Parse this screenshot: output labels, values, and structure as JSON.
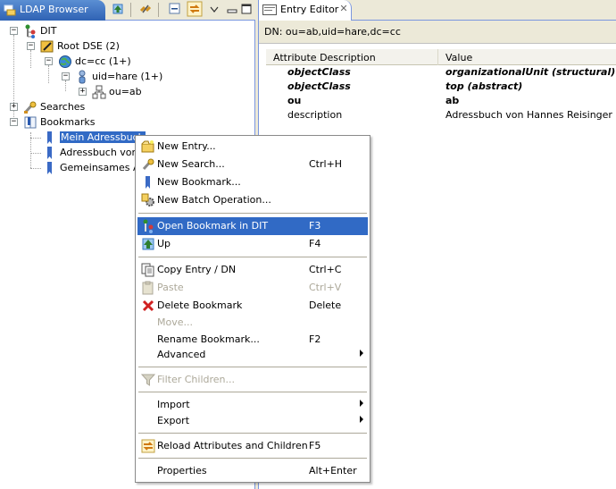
{
  "left_view": {
    "tab_title": "LDAP Browser"
  },
  "tree": {
    "dit": "DIT",
    "root_dse": "Root DSE (2)",
    "dc_cc": "dc=cc  (1+)",
    "uid_hare": "uid=hare (1+)",
    "ou_ab": "ou=ab",
    "searches": "Searches",
    "bookmarks": "Bookmarks",
    "bookmark_items": [
      "Mein Adressbuch",
      "Adressbuch von H",
      "Gemeinsames Adr"
    ]
  },
  "right_view": {
    "tab_title": "Entry Editor",
    "dn": "DN: ou=ab,uid=hare,dc=cc",
    "columns": [
      "Attribute Description",
      "Value"
    ],
    "rows": [
      {
        "attr": "objectClass",
        "value": "organizationalUnit (structural)"
      },
      {
        "attr": "objectClass",
        "value": "top (abstract)"
      },
      {
        "attr": "ou",
        "value": "ab"
      },
      {
        "attr": "description",
        "value": "Adressbuch von Hannes Reisinger"
      }
    ]
  },
  "context_menu": {
    "new_entry": "New Entry...",
    "new_search": "New Search...",
    "new_search_accel": "Ctrl+H",
    "new_bookmark": "New Bookmark...",
    "new_batch": "New Batch Operation...",
    "open_bookmark": "Open Bookmark in DIT",
    "open_bookmark_accel": "F3",
    "up": "Up",
    "up_accel": "F4",
    "copy_entry": "Copy Entry / DN",
    "copy_entry_accel": "Ctrl+C",
    "paste": "Paste",
    "paste_accel": "Ctrl+V",
    "delete_bookmark": "Delete Bookmark",
    "delete_accel": "Delete",
    "move": "Move...",
    "rename_bookmark": "Rename Bookmark...",
    "rename_accel": "F2",
    "advanced": "Advanced",
    "filter_children": "Filter Children...",
    "import": "Import",
    "export": "Export",
    "reload": "Reload Attributes and Children",
    "reload_accel": "F5",
    "properties": "Properties",
    "properties_accel": "Alt+Enter"
  },
  "colors": {
    "selection": "#316ac5",
    "active_tab": "#2f62b4",
    "disabled_text": "#aca899"
  }
}
